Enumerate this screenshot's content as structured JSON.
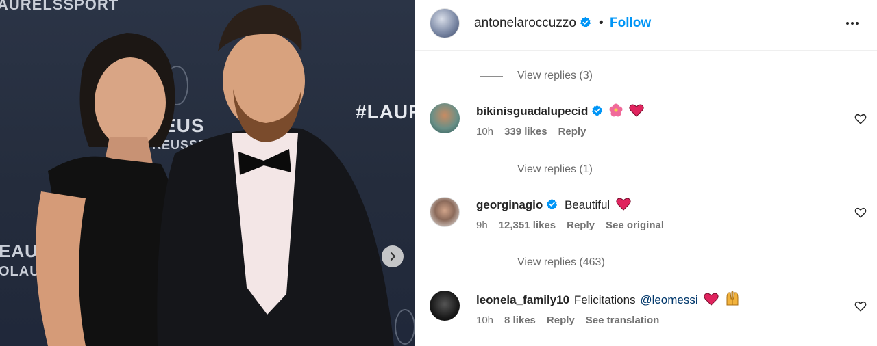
{
  "photo": {
    "backdrop_texts": [
      "AURELSSPORT",
      "#LAUR",
      "EUS",
      "REUSSPORT",
      "EAU",
      "OLAUR"
    ],
    "next_icon": "chevron-right-icon"
  },
  "post": {
    "username": "antonelaroccuzzo",
    "separator": "•",
    "follow_label": "Follow",
    "more_icon": "more-horizontal-icon",
    "verified_color": "#0095f6"
  },
  "replies": [
    {
      "label": "View replies (3)"
    },
    {
      "label": "View replies (1)"
    },
    {
      "label": "View replies (463)"
    }
  ],
  "comments": [
    {
      "username": "bikinisguadalupecid",
      "verified": true,
      "text": "",
      "mention": "",
      "emojis": [
        "hibiscus-icon",
        "heart-icon"
      ],
      "time": "10h",
      "likes": "339 likes",
      "reply": "Reply",
      "extra": ""
    },
    {
      "username": "georginagio",
      "verified": true,
      "text": "Beautiful",
      "mention": "",
      "emojis": [
        "heart-icon"
      ],
      "time": "9h",
      "likes": "12,351 likes",
      "reply": "Reply",
      "extra": "See original"
    },
    {
      "username": "leonela_family10",
      "verified": false,
      "text": "Felicitations",
      "mention": "@leomessi",
      "emojis": [
        "heart-icon",
        "raised-hands-icon"
      ],
      "time": "10h",
      "likes": "8 likes",
      "reply": "Reply",
      "extra": "See translation"
    }
  ],
  "colors": {
    "accent": "#0095f6",
    "text": "#262626",
    "muted": "#737373",
    "mention": "#00376b",
    "emoji_heart": "#e0245e"
  }
}
